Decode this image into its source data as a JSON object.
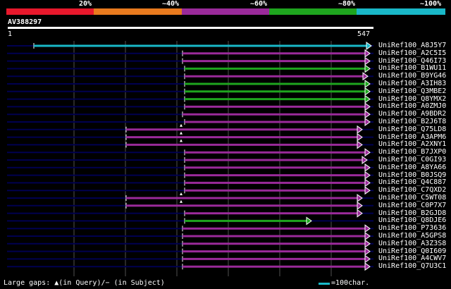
{
  "legend": {
    "percent_labels": [
      "20%",
      "~40%",
      "~60%",
      "~80%",
      "~100%"
    ],
    "band_colors": [
      "#e8182c",
      "#e87a1e",
      "#9a2a9a",
      "#1ea51e",
      "#19b8c8"
    ]
  },
  "query": {
    "id": "AV388297",
    "start": "1",
    "end": "547"
  },
  "hits": [
    {
      "name": "UniRef100_A8J5Y7",
      "color": "#19b8c8"
    },
    {
      "name": "UniRef100_A2C5I5",
      "color": "#9a2a9a"
    },
    {
      "name": "UniRef100_Q46I73",
      "color": "#9a2a9a"
    },
    {
      "name": "UniRef100_B1WU11",
      "color": "#1ea51e"
    },
    {
      "name": "UniRef100_B9YG46",
      "color": "#9a2a9a"
    },
    {
      "name": "UniRef100_A3IH83",
      "color": "#1ea51e"
    },
    {
      "name": "UniRef100_Q3MBE2",
      "color": "#1ea51e"
    },
    {
      "name": "UniRef100_Q8YMX2",
      "color": "#1ea51e"
    },
    {
      "name": "UniRef100_A0ZMJ0",
      "color": "#9a2a9a"
    },
    {
      "name": "UniRef100_A9BDR2",
      "color": "#9a2a9a"
    },
    {
      "name": "UniRef100_B2J6T8",
      "color": "#9a2a9a"
    },
    {
      "name": "UniRef100_Q75LD8",
      "color": "#9a2a9a"
    },
    {
      "name": "UniRef100_A3APM6",
      "color": "#9a2a9a"
    },
    {
      "name": "UniRef100_A2XNY1",
      "color": "#9a2a9a"
    },
    {
      "name": "UniRef100_B7JXP0",
      "color": "#9a2a9a"
    },
    {
      "name": "UniRef100_C0GI93",
      "color": "#9a2a9a"
    },
    {
      "name": "UniRef100_A8YA66",
      "color": "#9a2a9a"
    },
    {
      "name": "UniRef100_B0JSQ9",
      "color": "#9a2a9a"
    },
    {
      "name": "UniRef100_Q4C887",
      "color": "#9a2a9a"
    },
    {
      "name": "UniRef100_C7QXD2",
      "color": "#9a2a9a"
    },
    {
      "name": "UniRef100_C5WT08",
      "color": "#9a2a9a"
    },
    {
      "name": "UniRef100_C0P7X7",
      "color": "#9a2a9a"
    },
    {
      "name": "UniRef100_B2GJD8",
      "color": "#9a2a9a"
    },
    {
      "name": "UniRef100_Q8DJE6",
      "color": "#1ea51e"
    },
    {
      "name": "UniRef100_P73636",
      "color": "#9a2a9a"
    },
    {
      "name": "UniRef100_A5GPS8",
      "color": "#9a2a9a"
    },
    {
      "name": "UniRef100_A3Z3S8",
      "color": "#9a2a9a"
    },
    {
      "name": "UniRef100_Q0I609",
      "color": "#9a2a9a"
    },
    {
      "name": "UniRef100_A4CWV7",
      "color": "#9a2a9a"
    },
    {
      "name": "UniRef100_Q7U3C1",
      "color": "#9a2a9a"
    }
  ],
  "footer": {
    "gaps_text": "Large gaps: ▲(in Query)/− (in Subject)",
    "scale_text": "=100char.",
    "scale_color": "#19b8c8"
  },
  "colors": {
    "background": "#000000",
    "track": "#000050",
    "ruler": "#ffffff",
    "grid": "#505050"
  }
}
